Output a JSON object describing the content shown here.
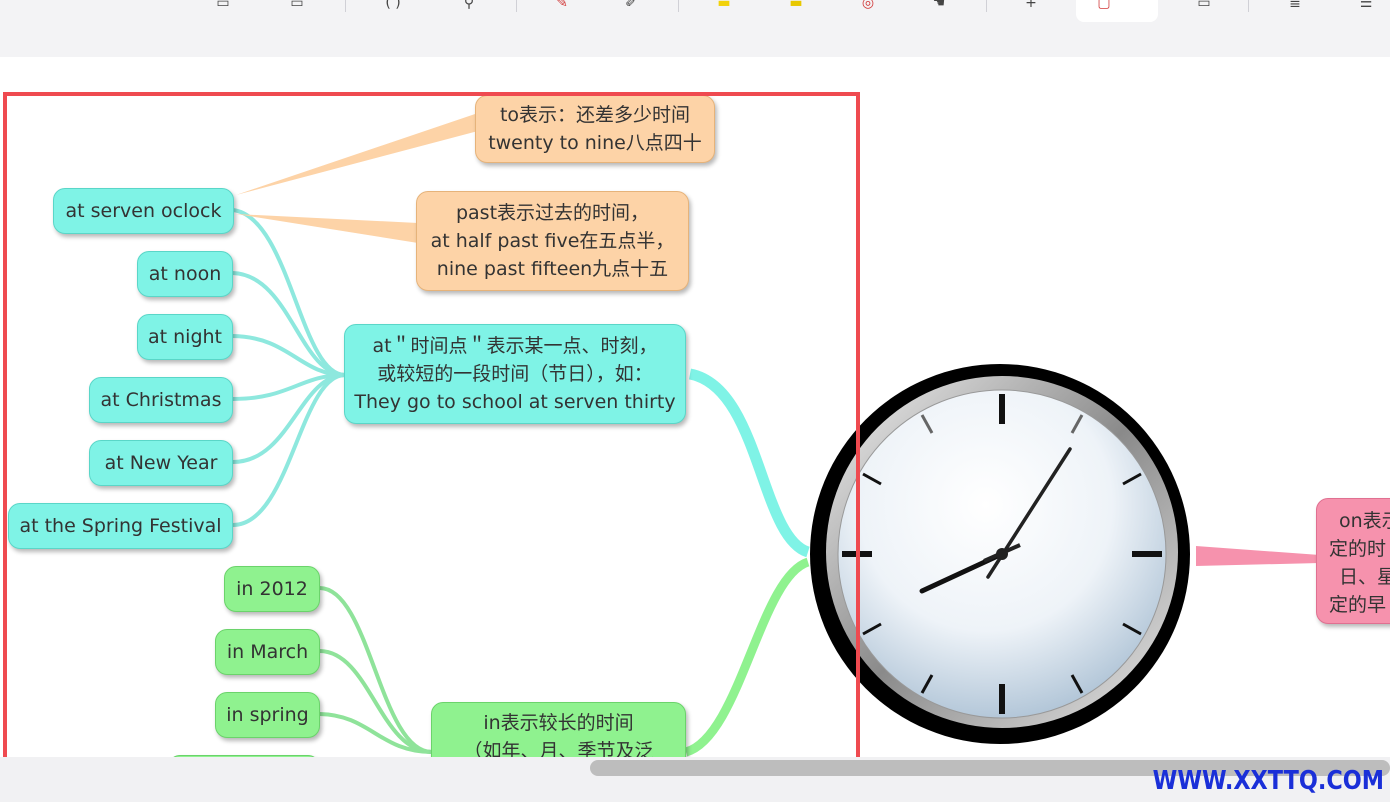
{
  "toolbar": {
    "icons": [
      "document-icon",
      "comment-icon",
      "brackets-icon",
      "search-icon",
      "pen-icon",
      "eraser-icon",
      "highlighter-icon",
      "marker-icon",
      "shape-icon",
      "lasso-icon",
      "add-icon",
      "layout-icon",
      "export-icon",
      "outline-icon",
      "list-icon"
    ],
    "glyphs": [
      "▭",
      "▭",
      "( )",
      "⚲",
      "✎",
      "✐",
      "▬",
      "▬",
      "◎",
      "☚",
      "+",
      "▢",
      "▭",
      "≣",
      "☰"
    ]
  },
  "mindmap": {
    "at_node": {
      "lines": [
        "at＂时间点＂表示某一点、时刻，",
        "或较短的一段时间（节日），如：",
        "They go to school at serven thirty"
      ]
    },
    "at_children": [
      "at serven oclock",
      "at noon",
      "at night",
      "at Christmas",
      "at New Year",
      "at the Spring Festival"
    ],
    "to_note": {
      "lines": [
        "to表示：还差多少时间",
        "twenty to nine八点四十"
      ]
    },
    "past_note": {
      "lines": [
        "past表示过去的时间，",
        "at half past five在五点半，",
        "nine past fifteen九点十五"
      ]
    },
    "in_node": {
      "lines": [
        "in表示较长的时间",
        "（如年、月、季节及泛"
      ]
    },
    "in_children": [
      "in 2012",
      "in March",
      "in spring"
    ],
    "on_node": {
      "lines": [
        "on表示",
        "定的时",
        "日、星",
        "定的早"
      ]
    },
    "center_image": "clock-icon"
  },
  "colors": {
    "at_branch": "#7ff3e6",
    "in_branch": "#8ff28f",
    "note": "#fdd3a7",
    "on_branch": "#f692ad",
    "selection": "#ef4a50"
  },
  "watermark": "WWW.XXTTQ.COM"
}
